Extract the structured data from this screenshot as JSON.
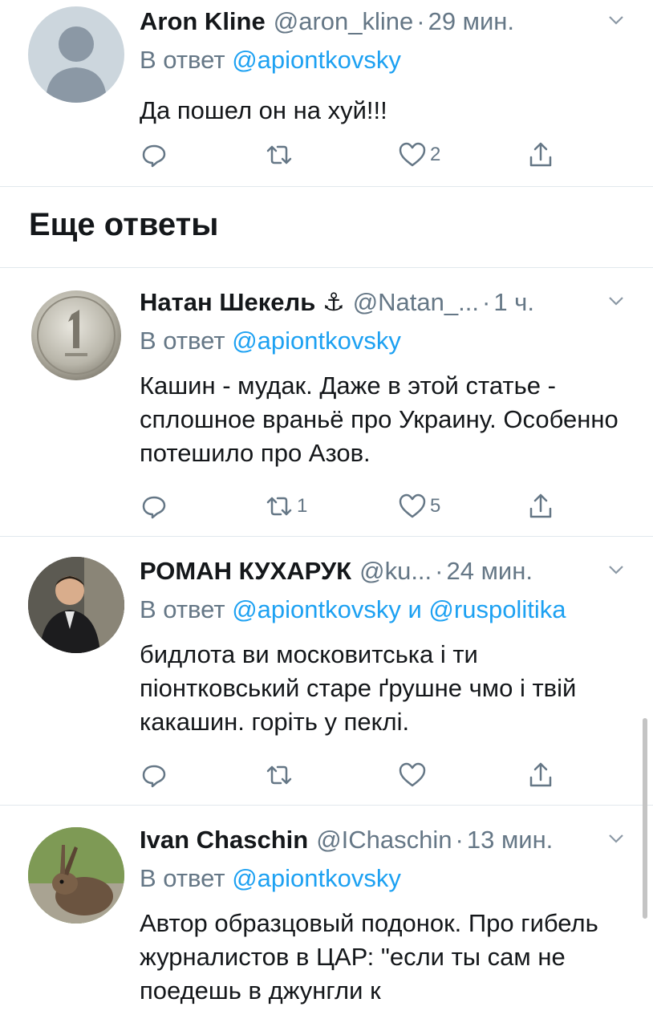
{
  "tweets": [
    {
      "name": "Aron Kline",
      "handle": "@aron_kline",
      "time": "29 мин.",
      "reply_prefix": "В ответ",
      "reply_to": "@apiontkovsky",
      "text": "Да пошел он на хуй!!!",
      "retweets": "",
      "likes": "2",
      "avatar": "default-avatar"
    },
    {
      "name": "Натан Шекель ⚓",
      "handle": "@Natan_...",
      "time": "1 ч.",
      "reply_prefix": "В ответ",
      "reply_to": "@apiontkovsky",
      "text": "Кашин - мудак. Даже в этой статье - сплошное враньё про Украину. Особенно потешило про Азов.",
      "retweets": "1",
      "likes": "5",
      "avatar": "coin-avatar"
    },
    {
      "name": "РОМАН КУХАРУК",
      "handle": "@ku...",
      "time": "24 мин.",
      "reply_prefix": "В ответ",
      "reply_to": "@apiontkovsky и @ruspolitika",
      "text": "бидлота ви московитська і ти піонтковський старе ґрушне чмо і твій какашин. горіть у пеклі.",
      "retweets": "",
      "likes": "",
      "avatar": "photo-avatar"
    },
    {
      "name": "Ivan Chaschin",
      "handle": "@IChaschin",
      "time": "13 мин.",
      "reply_prefix": "В ответ",
      "reply_to": "@apiontkovsky",
      "text": "Автор образцовый подонок. Про гибель журналистов в ЦАР: \"если ты сам не поедешь в джунгли к",
      "retweets": "",
      "likes": "",
      "avatar": "hare-avatar"
    }
  ],
  "section_title": "Еще ответы",
  "colors": {
    "link": "#1da1f2",
    "secondary": "#657786",
    "divider": "#e1e8ed"
  }
}
